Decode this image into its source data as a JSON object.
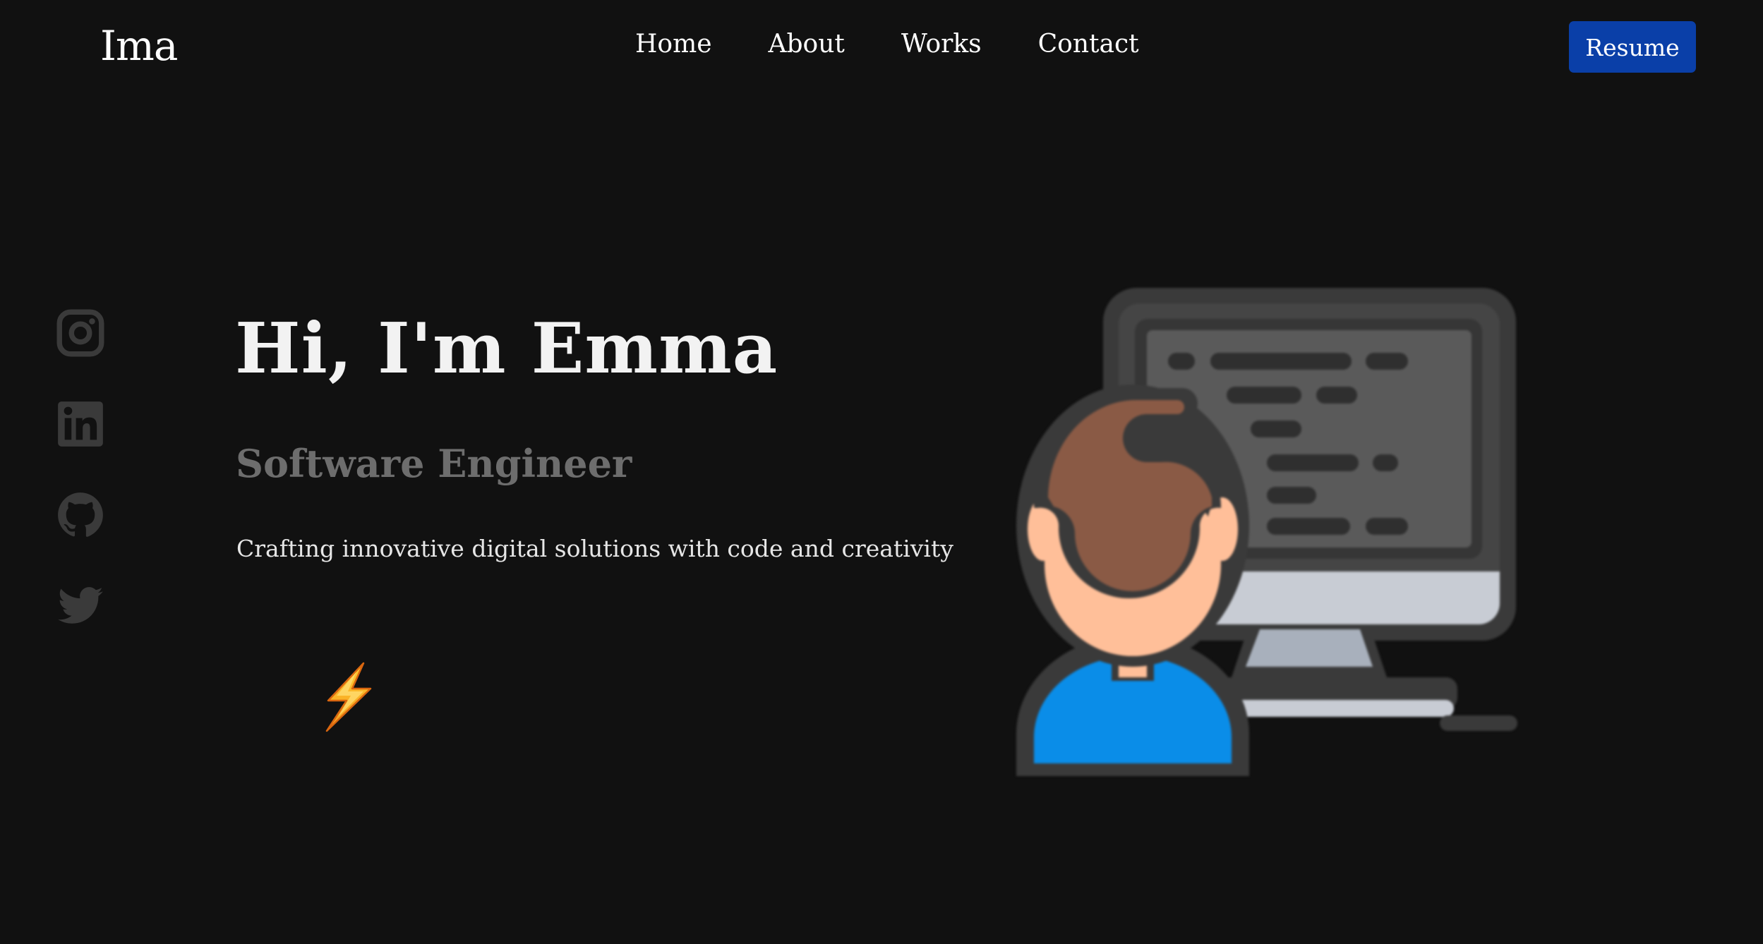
{
  "header": {
    "brand": "Ima",
    "nav": [
      "Home",
      "About",
      "Works",
      "Contact"
    ],
    "resume_label": "Resume"
  },
  "socials": [
    {
      "name": "instagram",
      "icon": "instagram-icon"
    },
    {
      "name": "linkedin",
      "icon": "linkedin-icon"
    },
    {
      "name": "github",
      "icon": "github-icon"
    },
    {
      "name": "twitter",
      "icon": "twitter-icon"
    }
  ],
  "hero": {
    "title": "Hi, I'm Emma",
    "role": "Software Engineer",
    "tagline": "Crafting innovative digital solutions with code and creativity",
    "decoration_icon": "lightning-bolt-icon",
    "illustration": "developer-at-computer-illustration"
  },
  "colors": {
    "background": "#111111",
    "accent": "#0a3fa8",
    "muted_text": "#6d6d6d",
    "social_icon": "#3a3a3a"
  }
}
